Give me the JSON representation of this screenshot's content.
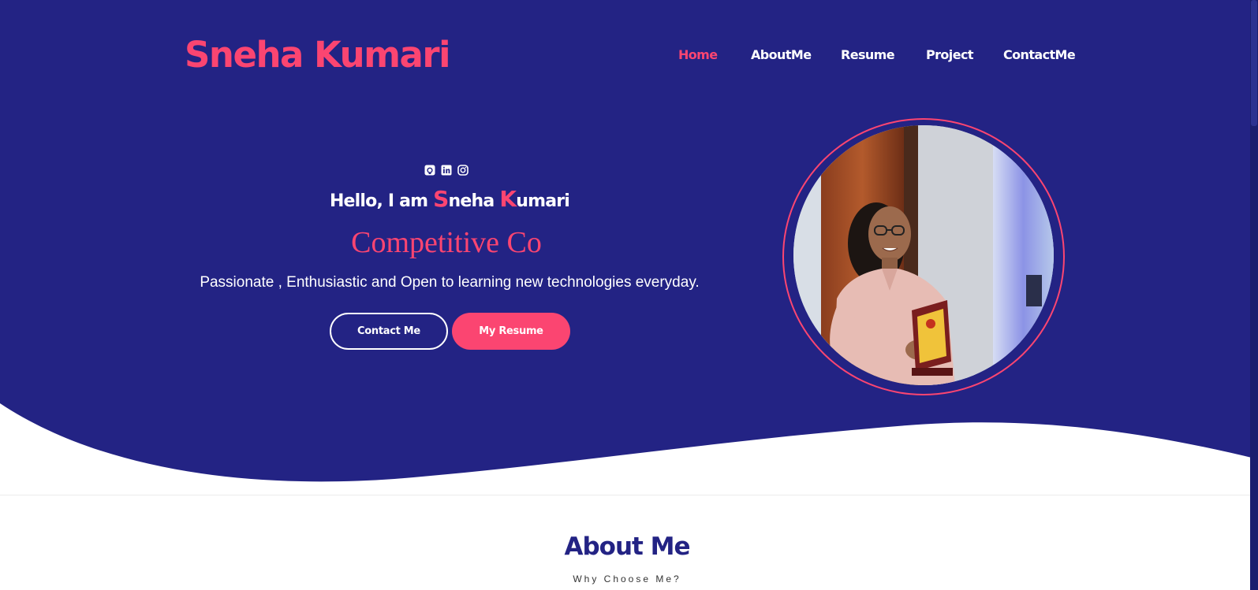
{
  "brand": {
    "name": "Sneha Kumari"
  },
  "nav": {
    "items": [
      {
        "label": "Home",
        "active": true
      },
      {
        "label": "AboutMe",
        "active": false
      },
      {
        "label": "Resume",
        "active": false
      },
      {
        "label": "Project",
        "active": false
      },
      {
        "label": "ContactMe",
        "active": false
      }
    ]
  },
  "hero": {
    "social_icons": [
      "github-icon",
      "linkedin-icon",
      "instagram-icon"
    ],
    "greeting_prefix": "Hello, I am ",
    "name_first_initial": "S",
    "name_first_rest": "neha ",
    "name_last_initial": "K",
    "name_last_rest": "umari",
    "typed_text": "Competitive Co",
    "tagline": "Passionate , Enthusiastic and Open to learning new technologies everyday.",
    "contact_button": "Contact Me",
    "resume_button": "My Resume"
  },
  "about": {
    "title": "About Me",
    "subtitle": "Why Choose Me?"
  },
  "colors": {
    "primary_navy": "#232384",
    "accent_pink": "#fb4571",
    "white": "#ffffff"
  }
}
